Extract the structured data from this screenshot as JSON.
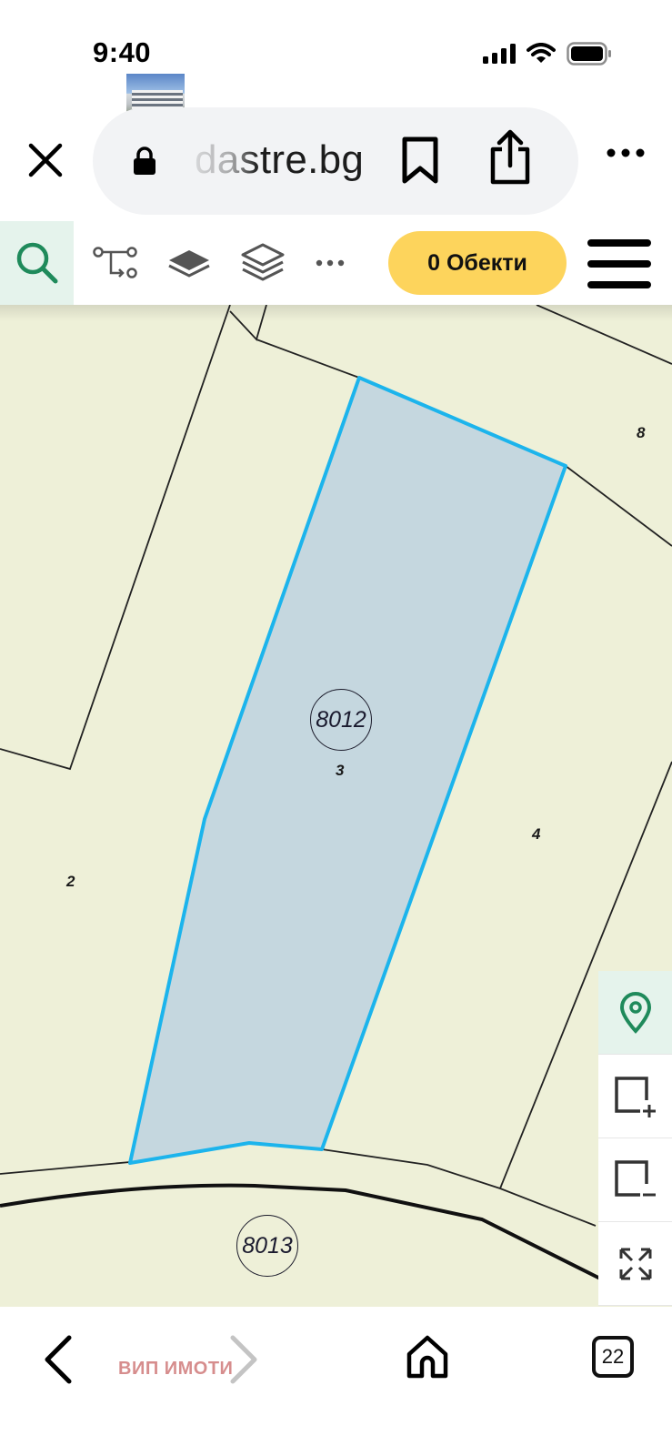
{
  "status_bar": {
    "time": "9:40",
    "icons": [
      "signal-icon",
      "wifi-icon",
      "battery-icon"
    ]
  },
  "browser": {
    "url": "dastre.bg",
    "buttons": [
      "close-icon",
      "lock-icon",
      "bookmark-icon",
      "share-icon",
      "more-icon"
    ]
  },
  "toolbar": {
    "tools": [
      "search-icon",
      "route-icon",
      "layer-icon",
      "layers-stack-icon",
      "more-icon"
    ],
    "objects_button": "0 Обекти",
    "menu_icon": "hamburger-icon"
  },
  "map": {
    "parcel_ids": {
      "selected": "8012",
      "road": "8013"
    },
    "parcel_labels": {
      "label_3": "3",
      "label_2": "2",
      "label_4": "4",
      "label_8": "8"
    },
    "colors": {
      "background": "#eef0d8",
      "selected_fill": "#c5d7df",
      "selected_outline": "#1cb4ec",
      "boundary": "#222222"
    }
  },
  "side_controls": [
    "location-pin-icon",
    "add-rectangle-icon",
    "remove-rectangle-icon",
    "fullscreen-icon"
  ],
  "bottom_nav": {
    "watermark": "ВИП ИМОТИ",
    "tab_count": "22",
    "icons": [
      "back-icon",
      "forward-icon",
      "home-icon",
      "tabs-icon"
    ]
  },
  "accent_colors": {
    "green": "#1f8a5b",
    "yellow": "#fdd45c"
  }
}
